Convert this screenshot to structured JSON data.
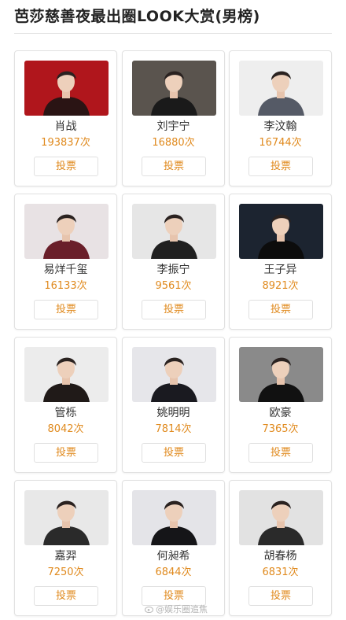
{
  "header": {
    "title": "芭莎慈善夜最出圈LOOK大赏(男榜)"
  },
  "vote_button_label": "投票",
  "vote_suffix": "次",
  "accent_color": "#e08a1e",
  "cards": [
    {
      "name": "肖战",
      "votes": "193837",
      "photo_bg": "#b0161c",
      "photo_fg": "#2a1414"
    },
    {
      "name": "刘宇宁",
      "votes": "16880",
      "photo_bg": "#5a544e",
      "photo_fg": "#1a1a1a"
    },
    {
      "name": "李汶翰",
      "votes": "16744",
      "photo_bg": "#eeeeee",
      "photo_fg": "#555a66"
    },
    {
      "name": "易烊千玺",
      "votes": "16133",
      "photo_bg": "#e8e2e4",
      "photo_fg": "#6a1f2a"
    },
    {
      "name": "李振宁",
      "votes": "9561",
      "photo_bg": "#e6e6e6",
      "photo_fg": "#202020"
    },
    {
      "name": "王子异",
      "votes": "8921",
      "photo_bg": "#1c2430",
      "photo_fg": "#0c0c0c"
    },
    {
      "name": "管栎",
      "votes": "8042",
      "photo_bg": "#ececec",
      "photo_fg": "#201a18"
    },
    {
      "name": "姚明明",
      "votes": "7814",
      "photo_bg": "#e6e6ea",
      "photo_fg": "#1a1a20"
    },
    {
      "name": "欧豪",
      "votes": "7365",
      "photo_bg": "#8a8a8a",
      "photo_fg": "#111111"
    },
    {
      "name": "嘉羿",
      "votes": "7250",
      "photo_bg": "#e8e8e8",
      "photo_fg": "#2a2a2a"
    },
    {
      "name": "何昶希",
      "votes": "6844",
      "photo_bg": "#e4e4e8",
      "photo_fg": "#151518"
    },
    {
      "name": "胡春杨",
      "votes": "6831",
      "photo_bg": "#e2e2e2",
      "photo_fg": "#2a2a2a"
    }
  ],
  "watermark": {
    "text": "@娱乐圈追焦"
  }
}
